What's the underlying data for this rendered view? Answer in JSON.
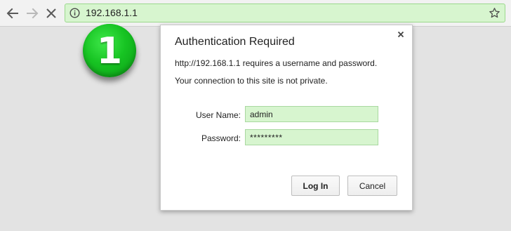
{
  "browser": {
    "address": "192.168.1.1",
    "icons": {
      "back": "arrow-left-icon",
      "forward": "arrow-right-icon",
      "stop": "close-icon",
      "site_info": "info-icon",
      "bookmark": "star-icon"
    },
    "omnibox_color": "#d7f5cf"
  },
  "step_badge": {
    "number": "1",
    "color": "#17c423"
  },
  "dialog": {
    "title": "Authentication Required",
    "message_line1": "http://192.168.1.1 requires a username and password.",
    "message_line2": "Your connection to this site is not private.",
    "username_label": "User Name:",
    "username_value": "admin",
    "password_label": "Password:",
    "password_value": "*********",
    "login_label": "Log In",
    "cancel_label": "Cancel",
    "close_icon": "close-icon"
  }
}
